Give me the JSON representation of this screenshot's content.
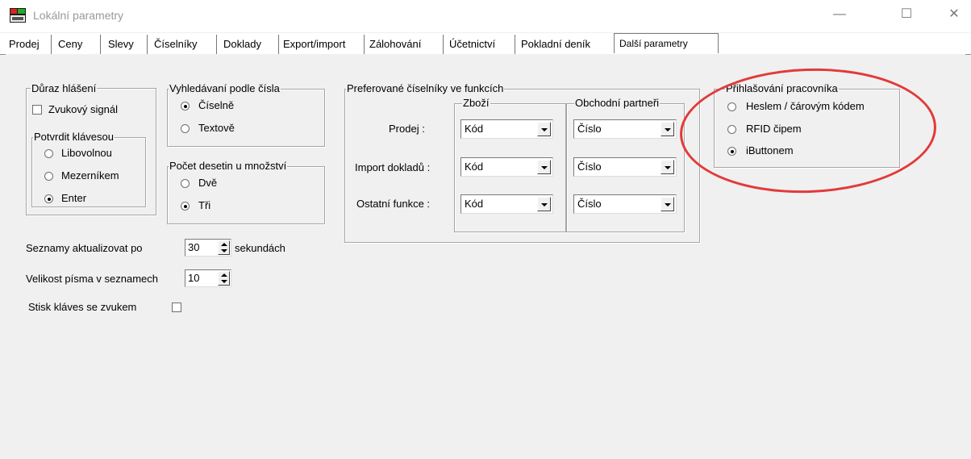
{
  "window": {
    "title": "Lokální parametry",
    "minimize": "—",
    "maximize": "☐",
    "close": "✕"
  },
  "tabs": [
    {
      "label": "Prodej"
    },
    {
      "label": "Ceny"
    },
    {
      "label": "Slevy"
    },
    {
      "label": "Číselníky"
    },
    {
      "label": "Doklady"
    },
    {
      "label": "Export/import"
    },
    {
      "label": "Zálohování"
    },
    {
      "label": "Účetnictví"
    },
    {
      "label": "Pokladní deník"
    },
    {
      "label": "Další parametry",
      "active": true
    }
  ],
  "duraz": {
    "title": "Důraz hlášení",
    "zvukovy": {
      "label": "Zvukový signál",
      "checked": false
    },
    "potvrdit": {
      "title": "Potvrdit klávesou",
      "options": [
        {
          "label": "Libovolnou",
          "selected": false
        },
        {
          "label": "Mezerníkem",
          "selected": false
        },
        {
          "label": "Enter",
          "selected": true
        }
      ]
    }
  },
  "vyhledavani": {
    "title": "Vyhledávaní podle čísla",
    "options": [
      {
        "label": "Číselně",
        "selected": true
      },
      {
        "label": "Textově",
        "selected": false
      }
    ]
  },
  "pocet_desetin": {
    "title": "Počet desetin u množství",
    "options": [
      {
        "label": "Dvě",
        "selected": false
      },
      {
        "label": "Tři",
        "selected": true
      }
    ]
  },
  "preferovane": {
    "title": "Preferované číselníky ve funkcích",
    "zbozi_title": "Zboží",
    "partneri_title": "Obchodní partneři",
    "rows": [
      {
        "label": "Prodej :",
        "zbozi": "Kód",
        "partner": "Číslo"
      },
      {
        "label": "Import dokladů :",
        "zbozi": "Kód",
        "partner": "Číslo"
      },
      {
        "label": "Ostatní funkce :",
        "zbozi": "Kód",
        "partner": "Číslo"
      }
    ]
  },
  "prihlasovani": {
    "title": "Přihlašování pracovníka",
    "options": [
      {
        "label": "Heslem / čárovým kódem",
        "selected": false
      },
      {
        "label": "RFID čipem",
        "selected": false
      },
      {
        "label": "iButtonem",
        "selected": true
      }
    ]
  },
  "seznamy": {
    "label": "Seznamy aktualizovat po",
    "value": "30",
    "suffix": "sekundách"
  },
  "velikost": {
    "label": "Velikost písma v seznamech",
    "value": "10"
  },
  "stisk": {
    "label": "Stisk kláves se zvukem",
    "checked": false
  },
  "colors": {
    "annotation": "#e23a3a",
    "background": "#f0f0f0"
  }
}
